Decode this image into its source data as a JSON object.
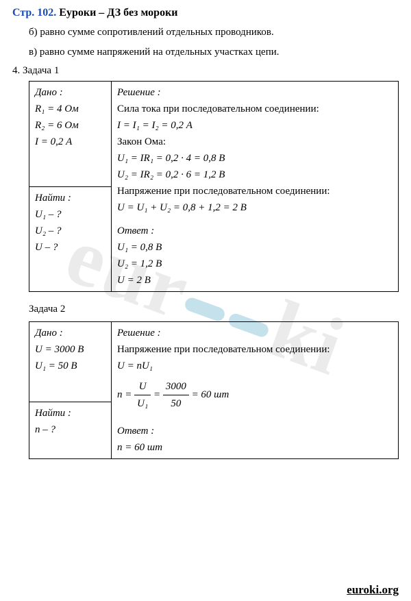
{
  "title": {
    "blue": "Стр. 102.",
    "rest": " Еуроки – ДЗ без мороки"
  },
  "intro": {
    "b": "б) равно сумме сопротивлений отдельных проводников.",
    "v": "в) равно сумме напряжений на отдельных участках цепи."
  },
  "task1_label": "4. Задача 1",
  "task1": {
    "given_hdr": "Дано :",
    "g1": "R₁ = 4 Ом",
    "g2": "R₂ = 6 Ом",
    "g3": "I = 0,2 А",
    "find_hdr": "Найти :",
    "f1": "U₁ – ?",
    "f2": "U₂ – ?",
    "f3": "U – ?",
    "sol_hdr": "Решение :",
    "s1": "Сила тока при последовательном соединении:",
    "s2": "I = I₁ = I₂ = 0,2 А",
    "s3": "Закон Ома:",
    "s4": "U₁ = IR₁ = 0,2 · 4 = 0,8 В",
    "s5": "U₂ = IR₂ = 0,2 · 6 = 1,2 В",
    "s6": "Напряжение при последовательном соединении:",
    "s7": "U = U₁ + U₂ = 0,8 + 1,2 = 2 В",
    "ans_hdr": "Ответ :",
    "a1": "U₁ = 0,8 В",
    "a2": "U₂ = 1,2 В",
    "a3": "U = 2 В"
  },
  "task2_label": "Задача 2",
  "task2": {
    "given_hdr": "Дано :",
    "g1": "U = 3000 В",
    "g2": "U₁ = 50 В",
    "find_hdr": "Найти :",
    "f1": "n – ?",
    "sol_hdr": "Решение :",
    "s1": "Напряжение при последовательном соединении:",
    "s2": "U = nU₁",
    "frac_lead": "n = ",
    "frac1_num": "U",
    "frac1_den": "U₁",
    "frac_eq": " = ",
    "frac2_num": "3000",
    "frac2_den": "50",
    "frac_tail": " = 60 шт",
    "ans_hdr": "Ответ :",
    "a1": "n = 60 шт"
  },
  "footer": "euroki.org",
  "watermark": "eur   ki"
}
